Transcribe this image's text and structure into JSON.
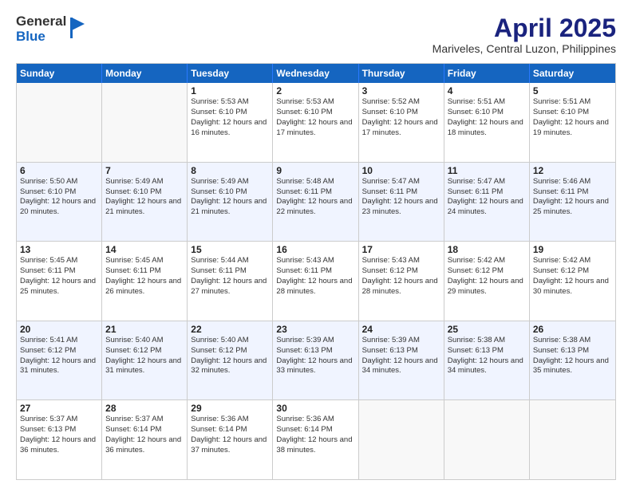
{
  "logo": {
    "general": "General",
    "blue": "Blue"
  },
  "title": {
    "month": "April 2025",
    "location": "Mariveles, Central Luzon, Philippines"
  },
  "header": {
    "days": [
      "Sunday",
      "Monday",
      "Tuesday",
      "Wednesday",
      "Thursday",
      "Friday",
      "Saturday"
    ]
  },
  "weeks": [
    {
      "cells": [
        {
          "day": "",
          "sunrise": "",
          "sunset": "",
          "daylight": ""
        },
        {
          "day": "",
          "sunrise": "",
          "sunset": "",
          "daylight": ""
        },
        {
          "day": "1",
          "sunrise": "Sunrise: 5:53 AM",
          "sunset": "Sunset: 6:10 PM",
          "daylight": "Daylight: 12 hours and 16 minutes."
        },
        {
          "day": "2",
          "sunrise": "Sunrise: 5:53 AM",
          "sunset": "Sunset: 6:10 PM",
          "daylight": "Daylight: 12 hours and 17 minutes."
        },
        {
          "day": "3",
          "sunrise": "Sunrise: 5:52 AM",
          "sunset": "Sunset: 6:10 PM",
          "daylight": "Daylight: 12 hours and 17 minutes."
        },
        {
          "day": "4",
          "sunrise": "Sunrise: 5:51 AM",
          "sunset": "Sunset: 6:10 PM",
          "daylight": "Daylight: 12 hours and 18 minutes."
        },
        {
          "day": "5",
          "sunrise": "Sunrise: 5:51 AM",
          "sunset": "Sunset: 6:10 PM",
          "daylight": "Daylight: 12 hours and 19 minutes."
        }
      ]
    },
    {
      "cells": [
        {
          "day": "6",
          "sunrise": "Sunrise: 5:50 AM",
          "sunset": "Sunset: 6:10 PM",
          "daylight": "Daylight: 12 hours and 20 minutes."
        },
        {
          "day": "7",
          "sunrise": "Sunrise: 5:49 AM",
          "sunset": "Sunset: 6:10 PM",
          "daylight": "Daylight: 12 hours and 21 minutes."
        },
        {
          "day": "8",
          "sunrise": "Sunrise: 5:49 AM",
          "sunset": "Sunset: 6:10 PM",
          "daylight": "Daylight: 12 hours and 21 minutes."
        },
        {
          "day": "9",
          "sunrise": "Sunrise: 5:48 AM",
          "sunset": "Sunset: 6:11 PM",
          "daylight": "Daylight: 12 hours and 22 minutes."
        },
        {
          "day": "10",
          "sunrise": "Sunrise: 5:47 AM",
          "sunset": "Sunset: 6:11 PM",
          "daylight": "Daylight: 12 hours and 23 minutes."
        },
        {
          "day": "11",
          "sunrise": "Sunrise: 5:47 AM",
          "sunset": "Sunset: 6:11 PM",
          "daylight": "Daylight: 12 hours and 24 minutes."
        },
        {
          "day": "12",
          "sunrise": "Sunrise: 5:46 AM",
          "sunset": "Sunset: 6:11 PM",
          "daylight": "Daylight: 12 hours and 25 minutes."
        }
      ]
    },
    {
      "cells": [
        {
          "day": "13",
          "sunrise": "Sunrise: 5:45 AM",
          "sunset": "Sunset: 6:11 PM",
          "daylight": "Daylight: 12 hours and 25 minutes."
        },
        {
          "day": "14",
          "sunrise": "Sunrise: 5:45 AM",
          "sunset": "Sunset: 6:11 PM",
          "daylight": "Daylight: 12 hours and 26 minutes."
        },
        {
          "day": "15",
          "sunrise": "Sunrise: 5:44 AM",
          "sunset": "Sunset: 6:11 PM",
          "daylight": "Daylight: 12 hours and 27 minutes."
        },
        {
          "day": "16",
          "sunrise": "Sunrise: 5:43 AM",
          "sunset": "Sunset: 6:11 PM",
          "daylight": "Daylight: 12 hours and 28 minutes."
        },
        {
          "day": "17",
          "sunrise": "Sunrise: 5:43 AM",
          "sunset": "Sunset: 6:12 PM",
          "daylight": "Daylight: 12 hours and 28 minutes."
        },
        {
          "day": "18",
          "sunrise": "Sunrise: 5:42 AM",
          "sunset": "Sunset: 6:12 PM",
          "daylight": "Daylight: 12 hours and 29 minutes."
        },
        {
          "day": "19",
          "sunrise": "Sunrise: 5:42 AM",
          "sunset": "Sunset: 6:12 PM",
          "daylight": "Daylight: 12 hours and 30 minutes."
        }
      ]
    },
    {
      "cells": [
        {
          "day": "20",
          "sunrise": "Sunrise: 5:41 AM",
          "sunset": "Sunset: 6:12 PM",
          "daylight": "Daylight: 12 hours and 31 minutes."
        },
        {
          "day": "21",
          "sunrise": "Sunrise: 5:40 AM",
          "sunset": "Sunset: 6:12 PM",
          "daylight": "Daylight: 12 hours and 31 minutes."
        },
        {
          "day": "22",
          "sunrise": "Sunrise: 5:40 AM",
          "sunset": "Sunset: 6:12 PM",
          "daylight": "Daylight: 12 hours and 32 minutes."
        },
        {
          "day": "23",
          "sunrise": "Sunrise: 5:39 AM",
          "sunset": "Sunset: 6:13 PM",
          "daylight": "Daylight: 12 hours and 33 minutes."
        },
        {
          "day": "24",
          "sunrise": "Sunrise: 5:39 AM",
          "sunset": "Sunset: 6:13 PM",
          "daylight": "Daylight: 12 hours and 34 minutes."
        },
        {
          "day": "25",
          "sunrise": "Sunrise: 5:38 AM",
          "sunset": "Sunset: 6:13 PM",
          "daylight": "Daylight: 12 hours and 34 minutes."
        },
        {
          "day": "26",
          "sunrise": "Sunrise: 5:38 AM",
          "sunset": "Sunset: 6:13 PM",
          "daylight": "Daylight: 12 hours and 35 minutes."
        }
      ]
    },
    {
      "cells": [
        {
          "day": "27",
          "sunrise": "Sunrise: 5:37 AM",
          "sunset": "Sunset: 6:13 PM",
          "daylight": "Daylight: 12 hours and 36 minutes."
        },
        {
          "day": "28",
          "sunrise": "Sunrise: 5:37 AM",
          "sunset": "Sunset: 6:14 PM",
          "daylight": "Daylight: 12 hours and 36 minutes."
        },
        {
          "day": "29",
          "sunrise": "Sunrise: 5:36 AM",
          "sunset": "Sunset: 6:14 PM",
          "daylight": "Daylight: 12 hours and 37 minutes."
        },
        {
          "day": "30",
          "sunrise": "Sunrise: 5:36 AM",
          "sunset": "Sunset: 6:14 PM",
          "daylight": "Daylight: 12 hours and 38 minutes."
        },
        {
          "day": "",
          "sunrise": "",
          "sunset": "",
          "daylight": ""
        },
        {
          "day": "",
          "sunrise": "",
          "sunset": "",
          "daylight": ""
        },
        {
          "day": "",
          "sunrise": "",
          "sunset": "",
          "daylight": ""
        }
      ]
    }
  ]
}
